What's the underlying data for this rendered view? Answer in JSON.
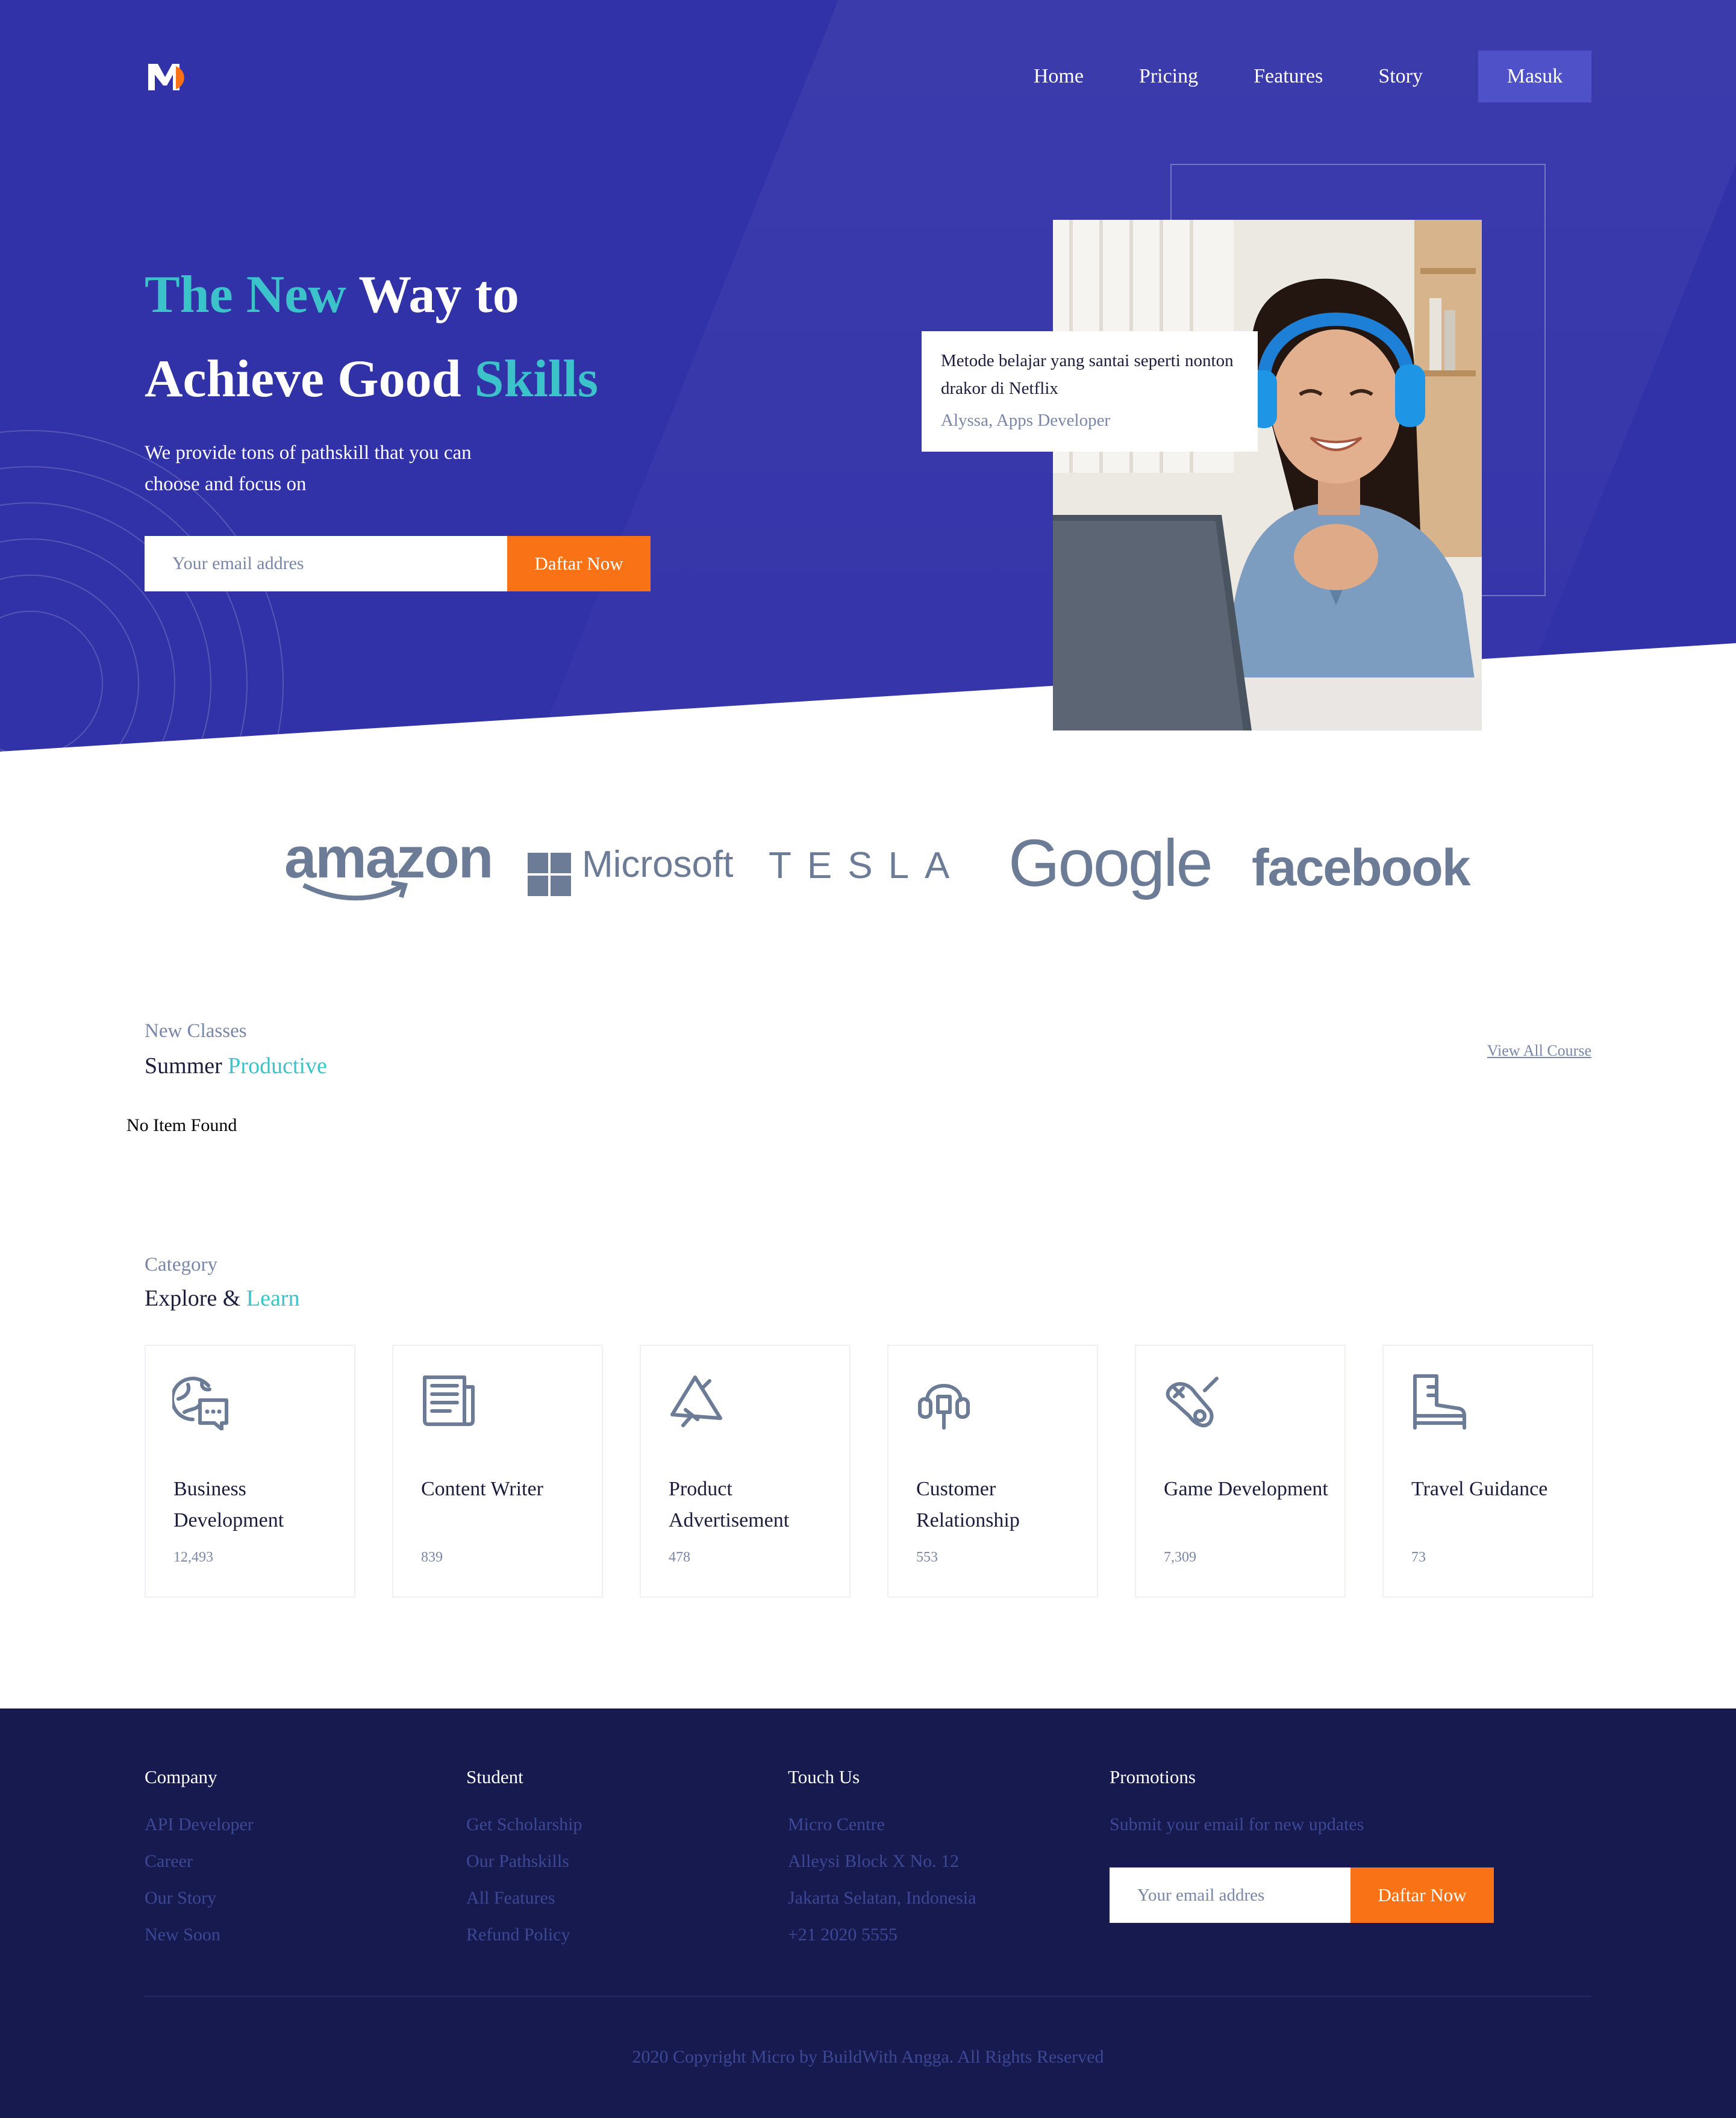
{
  "nav": {
    "items": [
      "Home",
      "Pricing",
      "Features",
      "Story"
    ],
    "login_label": "Masuk"
  },
  "hero": {
    "title_line1_a": "The New",
    "title_line1_b": " Way to",
    "title_line2_a": "Achieve Good ",
    "title_line2_b": "Skills",
    "subtitle": "We provide tons of pathskill that you can choose and focus on",
    "email_placeholder": "Your email addres",
    "cta_label": "Daftar Now",
    "quote_text": "Metode belajar yang santai seperti nonton drakor di Netflix",
    "quote_author": "Alyssa, Apps Developer"
  },
  "brands": [
    "amazon",
    "Microsoft",
    "TESLA",
    "Google",
    "facebook"
  ],
  "new_classes": {
    "label": "New Classes",
    "title_a": "Summer ",
    "title_b": "Productive",
    "view_all": "View All Course",
    "empty_text": "No Item Found"
  },
  "category": {
    "label": "Category",
    "title_a": "Explore & ",
    "title_b": "Learn",
    "items": [
      {
        "name": "Business Development",
        "count": "12,493",
        "icon": "globe-chat-icon"
      },
      {
        "name": "Content Writer",
        "count": "839",
        "icon": "document-icon"
      },
      {
        "name": "Product Advertisement",
        "count": "478",
        "icon": "megaphone-icon"
      },
      {
        "name": "Customer Relationship",
        "count": "553",
        "icon": "headset-icon"
      },
      {
        "name": "Game Development",
        "count": "7,309",
        "icon": "gamepad-icon"
      },
      {
        "name": "Travel Guidance",
        "count": "73",
        "icon": "boot-icon"
      }
    ]
  },
  "footer": {
    "company": {
      "title": "Company",
      "links": [
        "API Developer",
        "Career",
        "Our Story",
        "New Soon"
      ]
    },
    "student": {
      "title": "Student",
      "links": [
        "Get Scholarship",
        "Our Pathskills",
        "All Features",
        "Refund Policy"
      ]
    },
    "touch": {
      "title": "Touch Us",
      "lines": [
        "Micro Centre",
        "Alleysi Block X No. 12",
        "Jakarta Selatan, Indonesia",
        "+21 2020 5555"
      ]
    },
    "promotions": {
      "title": "Promotions",
      "text": "Submit your email for new updates",
      "email_placeholder": "Your email addres",
      "cta_label": "Daftar Now"
    },
    "copyright": "2020 Copyright Micro by BuildWith Angga. All Rights Reserved"
  },
  "colors": {
    "hero_bg": "#3131a8",
    "accent_teal": "#3cc3c9",
    "cta_orange": "#f97316",
    "footer_bg": "#161a4f",
    "muted_text": "#7a86a8"
  }
}
